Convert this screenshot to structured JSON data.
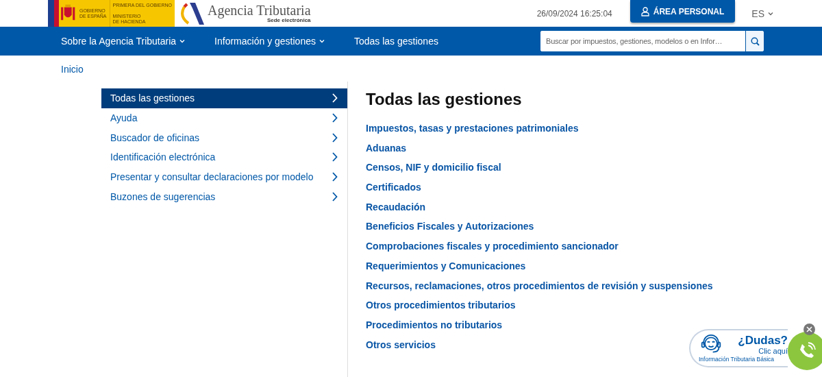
{
  "header": {
    "logo": {
      "gov_lines": [
        "GOBIERNO",
        "DE ESPAÑA"
      ],
      "ministry_top": "PRIMERA DEL GOBIERNO",
      "ministry_lines": [
        "MINISTERIO",
        "DE HACIENDA"
      ],
      "agency": "Agencia Tributaria",
      "subtitle": "Sede electrónica"
    },
    "datetime": "26/09/2024 16:25:04",
    "personal_button": "ÁREA PERSONAL",
    "language": "ES"
  },
  "nav": {
    "items": [
      {
        "label": "Sobre la Agencia Tributaria",
        "dropdown": true
      },
      {
        "label": "Información y gestiones",
        "dropdown": true
      },
      {
        "label": "Todas las gestiones",
        "dropdown": false
      }
    ],
    "search": {
      "placeholder": "Buscar por impuestos, gestiones, modelos o en Infor…"
    }
  },
  "breadcrumb": [
    "Inicio"
  ],
  "sidebar": {
    "items": [
      {
        "label": "Todas las gestiones",
        "selected": true
      },
      {
        "label": "Ayuda",
        "selected": false
      },
      {
        "label": "Buscador de oficinas",
        "selected": false
      },
      {
        "label": "Identificación electrónica",
        "selected": false
      },
      {
        "label": "Presentar y consultar declaraciones por modelo",
        "selected": false
      },
      {
        "label": "Buzones de sugerencias",
        "selected": false
      }
    ]
  },
  "main": {
    "title": "Todas las gestiones",
    "links": [
      "Impuestos, tasas y prestaciones patrimoniales",
      "Aduanas",
      "Censos, NIF y domicilio fiscal",
      "Certificados",
      "Recaudación",
      "Beneficios Fiscales y Autorizaciones",
      "Comprobaciones fiscales y procedimiento sancionador",
      "Requerimientos y Comunicaciones",
      "Recursos, reclamaciones, otros procedimientos de revisión y suspensiones",
      "Otros procedimientos tributarios",
      "Procedimientos no tributarios",
      "Otros servicios"
    ]
  },
  "help_widget": {
    "title": "¿Dudas?",
    "action": "Clic aquí",
    "caption": "Información Tributaria Básica"
  }
}
